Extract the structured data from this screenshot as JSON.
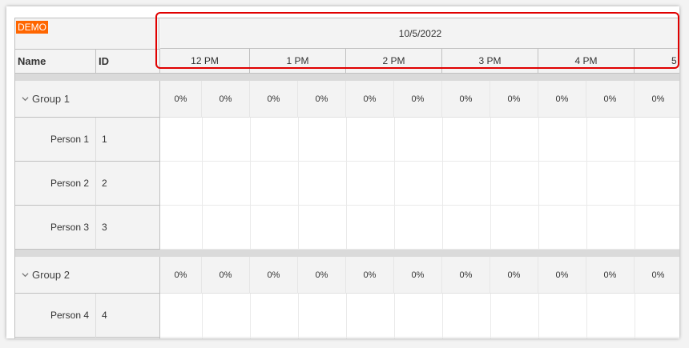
{
  "demo_label": "DEMO",
  "columns": {
    "name": "Name",
    "id": "ID"
  },
  "date_header": "10/5/2022",
  "hours": [
    "12 PM",
    "1 PM",
    "2 PM",
    "3 PM",
    "4 PM",
    "5"
  ],
  "groups": [
    {
      "label": "Group 1",
      "summary": [
        "0%",
        "0%",
        "0%",
        "0%",
        "0%",
        "0%",
        "0%",
        "0%",
        "0%",
        "0%",
        "0%"
      ],
      "people": [
        {
          "name": "Person 1",
          "id": "1"
        },
        {
          "name": "Person 2",
          "id": "2"
        },
        {
          "name": "Person 3",
          "id": "3"
        }
      ]
    },
    {
      "label": "Group 2",
      "summary": [
        "0%",
        "0%",
        "0%",
        "0%",
        "0%",
        "0%",
        "0%",
        "0%",
        "0%",
        "0%",
        "0%"
      ],
      "people": [
        {
          "name": "Person 4",
          "id": "4"
        }
      ]
    }
  ],
  "colors": {
    "demo_bg": "#ff6600",
    "highlight": "#e00000",
    "header_bg": "#f3f3f3"
  }
}
